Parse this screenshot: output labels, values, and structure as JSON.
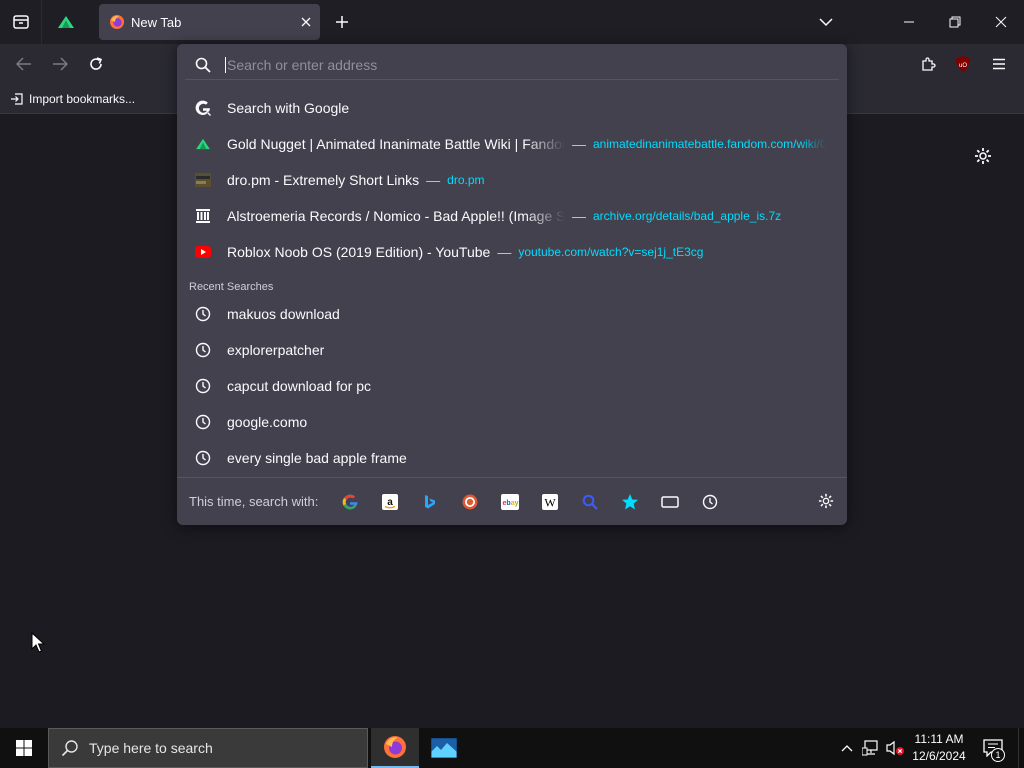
{
  "tabs": [
    {
      "title": "New Tab",
      "icon": "firefox-icon",
      "active": true
    }
  ],
  "pinned_tab": {
    "icon": "animatedinanimatebattle-icon"
  },
  "bookmarks": {
    "items": [
      {
        "label": "Import bookmarks..."
      }
    ]
  },
  "urlbar": {
    "placeholder": "Search or enter address",
    "value": ""
  },
  "results": {
    "search_with": {
      "label": "Search with Google",
      "icon": "google-icon"
    },
    "history": [
      {
        "title": "Gold Nugget | Animated Inanimate Battle Wiki | Fandom",
        "url": "animatedinanimatebattle.fandom.com/wiki/Gold_Nugget",
        "icon": "fandom-favicon"
      },
      {
        "title": "dro.pm - Extremely Short Links",
        "url": "dro.pm",
        "icon": "dropm-favicon"
      },
      {
        "title": "Alstroemeria Records / Nomico - Bad Apple!! (Image Sequence)",
        "url": "archive.org/details/bad_apple_is.7z",
        "icon": "archive-org-favicon"
      },
      {
        "title": "Roblox Noob OS (2019 Edition) - YouTube",
        "url": "youtube.com/watch?v=sej1j_tE3cg",
        "icon": "youtube-favicon"
      }
    ],
    "recent_searches_label": "Recent Searches",
    "recent_searches": [
      "makuos download",
      "explorerpatcher",
      "capcut download for pc",
      "google.como",
      "every single bad apple frame"
    ],
    "separator": "—"
  },
  "one_off": {
    "label": "This time, search with:",
    "engines": [
      "google-icon",
      "amazon-icon",
      "bing-icon",
      "duckduckgo-icon",
      "ebay-icon",
      "wikipedia-icon",
      "search-icon",
      "bookmarks-star-icon",
      "tabs-icon",
      "history-clock-icon"
    ]
  },
  "taskbar": {
    "search_placeholder": "Type here to search",
    "time": "11:11 AM",
    "date": "12/6/2024",
    "notification_count": "1"
  },
  "colors": {
    "accent_url": "#00ddff",
    "tab_active": "#42414d",
    "toolbar": "#2b2a33"
  }
}
